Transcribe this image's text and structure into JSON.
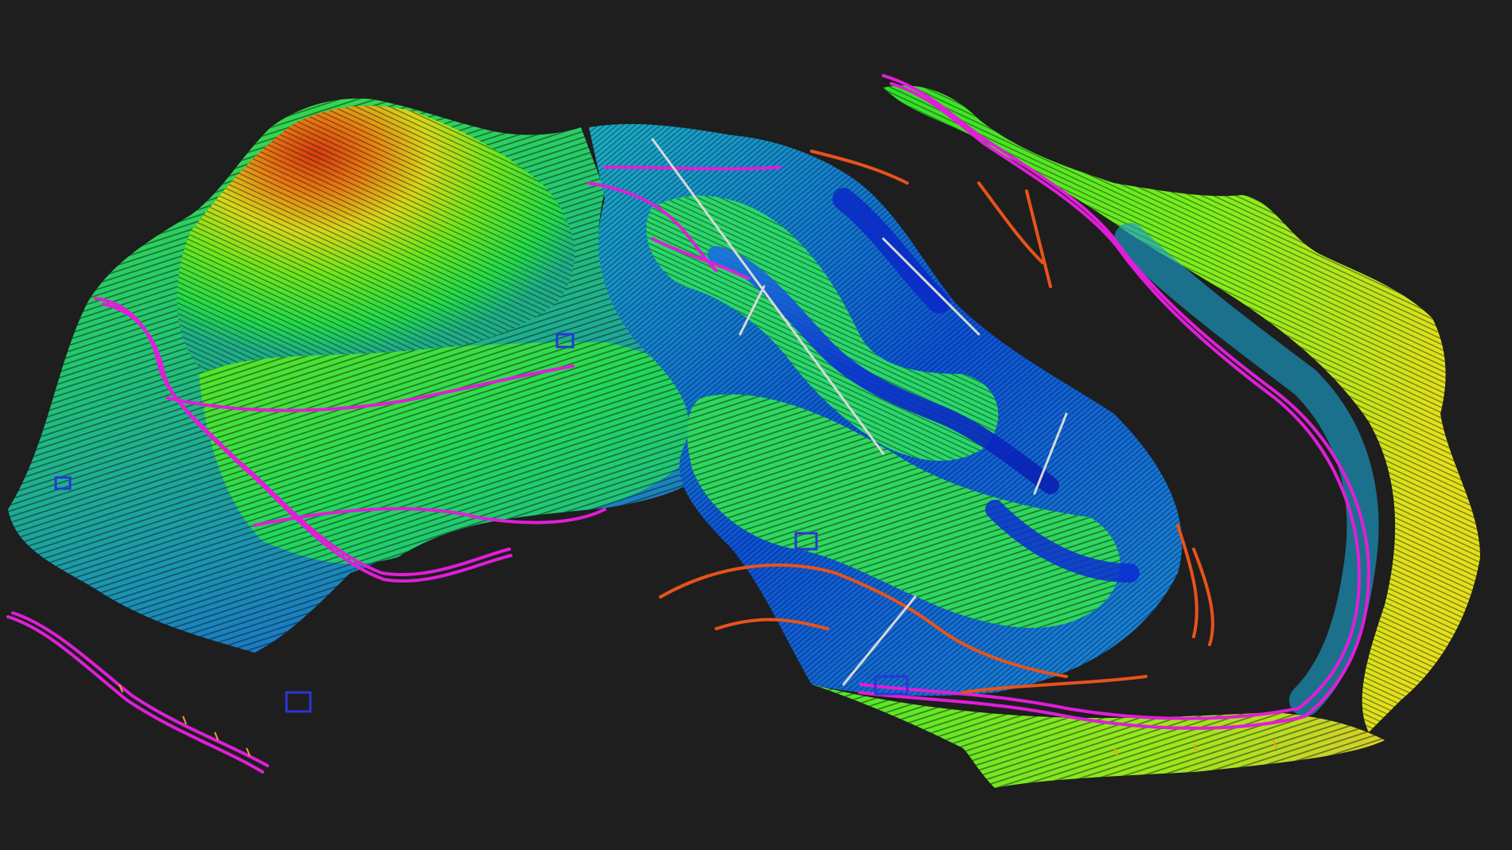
{
  "viewer": {
    "background_color": "#1e1e1e",
    "render_mode": "elevation-contours",
    "elevation_colormap": [
      "#0a2bd6",
      "#1aa3c8",
      "#22e04a",
      "#8df01c",
      "#e6e01a",
      "#f07a12",
      "#d8330e"
    ],
    "overlay_colors": {
      "road_edges": "#e01ed8",
      "infrastructure": "#e8531a",
      "cable_lines": "#d9d9d9",
      "structures": "#2a35d8",
      "survey_ticks": "#f0a020"
    }
  }
}
